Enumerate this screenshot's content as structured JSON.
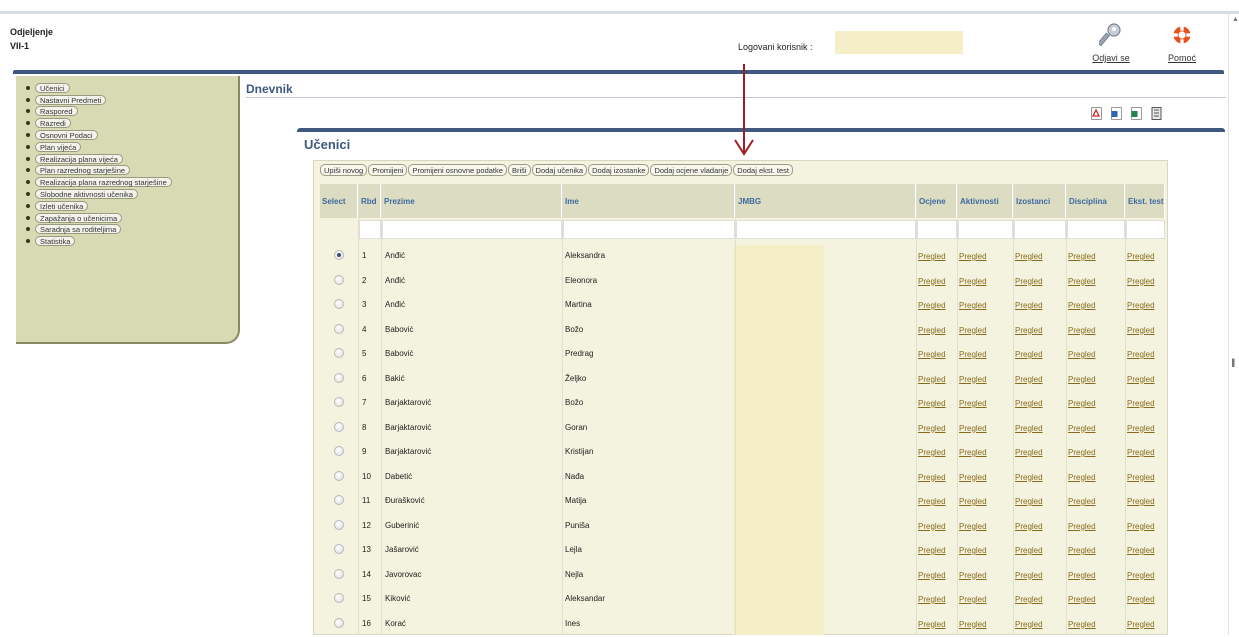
{
  "header": {
    "dept_label": "Odjeljenje",
    "dept_value": "VII-1",
    "logged_label": "Logovani korisnik :",
    "logout": "Odjavi se",
    "help": "Pomoć"
  },
  "sidebar": {
    "items": [
      {
        "label": "Učenici"
      },
      {
        "label": "Nastavni Predmeti"
      },
      {
        "label": "Raspored"
      },
      {
        "label": "Razredi"
      },
      {
        "label": "Osnovni Podaci"
      },
      {
        "label": "Plan vijeća"
      },
      {
        "label": "Realizacija plana vijeća"
      },
      {
        "label": "Plan razrednog starješine"
      },
      {
        "label": "Realizacija plana razrednog starješine"
      },
      {
        "label": "Slobodne aktivnosti učenika"
      },
      {
        "label": "Izleti učenika"
      },
      {
        "label": "Zapažanja o učenicima"
      },
      {
        "label": "Saradnja sa roditeljima"
      },
      {
        "label": "Statistika"
      }
    ]
  },
  "main": {
    "title": "Dnevnik",
    "toolbar_icons": [
      "pdf-icon",
      "word-icon",
      "excel-icon",
      "notebook-icon"
    ],
    "panel_title": "Učenici",
    "actions": [
      "Upiši novog",
      "Promijeni",
      "Promijeni osnovne podatke",
      "Briši",
      "Dodaj učenika",
      "Dodaj izostanke",
      "Dodaj ocjene vladanje",
      "Dodaj ekst. test"
    ],
    "columns": [
      "Select",
      "Rbd",
      "Prezime",
      "Ime",
      "JMBG",
      "Ocjene",
      "Aktivnosti",
      "Izostanci",
      "Disciplina",
      "Ekst. test"
    ],
    "link_text": "Pregled",
    "rows": [
      {
        "rbd": "1",
        "prezime": "Anđić",
        "ime": "Aleksandra"
      },
      {
        "rbd": "2",
        "prezime": "Anđić",
        "ime": "Eleonora"
      },
      {
        "rbd": "3",
        "prezime": "Anđić",
        "ime": "Martina"
      },
      {
        "rbd": "4",
        "prezime": "Baboviċ",
        "ime": "Božo"
      },
      {
        "rbd": "5",
        "prezime": "Baboviċ",
        "ime": "Predrag"
      },
      {
        "rbd": "6",
        "prezime": "Bakić",
        "ime": "Željko"
      },
      {
        "rbd": "7",
        "prezime": "Barjaktarović",
        "ime": "Božo"
      },
      {
        "rbd": "8",
        "prezime": "Barjaktarović",
        "ime": "Goran"
      },
      {
        "rbd": "9",
        "prezime": "Barjaktarović",
        "ime": "Kristijan"
      },
      {
        "rbd": "10",
        "prezime": "Dabetić",
        "ime": "Nađa"
      },
      {
        "rbd": "11",
        "prezime": "Đurašković",
        "ime": "Matija"
      },
      {
        "rbd": "12",
        "prezime": "Guberinić",
        "ime": "Puniša"
      },
      {
        "rbd": "13",
        "prezime": "Jašarović",
        "ime": "Lejla"
      },
      {
        "rbd": "14",
        "prezime": "Javorovac",
        "ime": "Nejla"
      },
      {
        "rbd": "15",
        "prezime": "Kiković",
        "ime": "Aleksandar"
      },
      {
        "rbd": "16",
        "prezime": "Korać",
        "ime": "Ines"
      }
    ]
  }
}
